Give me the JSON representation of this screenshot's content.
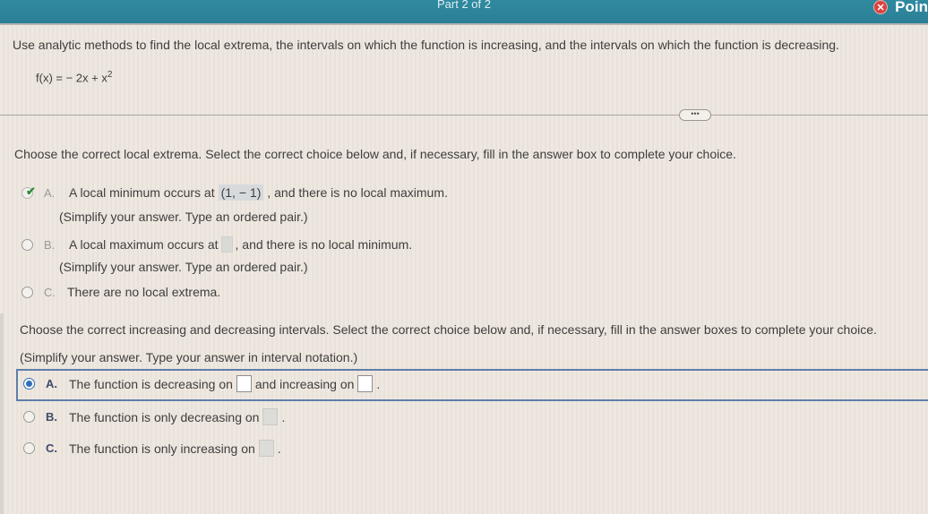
{
  "header": {
    "part_label": "Part 2 of 2",
    "points_label": "Poin",
    "status_icon": "x-circle-icon"
  },
  "question": {
    "instructions": "Use analytic methods to find the local extrema, the intervals on which the function is increasing, and the intervals on which the function is decreasing.",
    "function_prefix": "f(x) = − 2x + x",
    "function_exponent": "2",
    "more_button_label": "•••"
  },
  "part1": {
    "prompt": "Choose the correct local extrema. Select the correct choice below and, if necessary, fill in the answer box to complete your choice.",
    "options": [
      {
        "letter": "A.",
        "text_before": "A local minimum occurs at",
        "answer": "(1, − 1)",
        "text_after": ", and there is no local maximum.",
        "hint": "(Simplify your answer. Type an ordered pair.)",
        "state": "correct"
      },
      {
        "letter": "B.",
        "text_before": "A local maximum occurs at",
        "answer": "",
        "text_after": ", and there is no local minimum.",
        "hint": "(Simplify your answer. Type an ordered pair.)",
        "state": "unselected"
      },
      {
        "letter": "C.",
        "text": "There are no local extrema.",
        "state": "unselected"
      }
    ]
  },
  "part2": {
    "prompt": "Choose the correct increasing and decreasing intervals. Select the correct choice below and, if necessary, fill in the answer boxes to complete your choice.",
    "hint": "(Simplify your answer. Type your answer in interval notation.)",
    "options": [
      {
        "letter": "A.",
        "text_before": "The function is decreasing on",
        "answer1": "",
        "text_middle": "and increasing on",
        "answer2": "",
        "text_after": ".",
        "state": "selected"
      },
      {
        "letter": "B.",
        "text_before": "The function is only decreasing on",
        "answer": "",
        "text_after": ".",
        "state": "unselected"
      },
      {
        "letter": "C.",
        "text_before": "The function is only increasing on",
        "answer": "",
        "text_after": ".",
        "state": "unselected"
      }
    ]
  }
}
